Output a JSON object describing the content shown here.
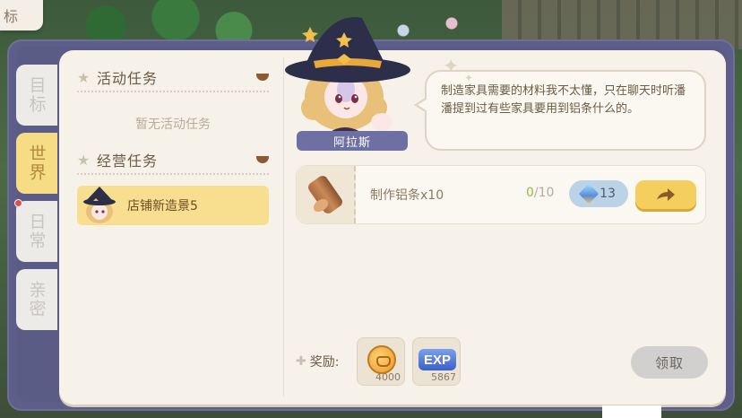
{
  "corner_tag": "标",
  "tabs": [
    {
      "label": "目标",
      "active": false,
      "dot": false
    },
    {
      "label": "世界",
      "active": true,
      "dot": false
    },
    {
      "label": "日常",
      "active": false,
      "dot": true
    },
    {
      "label": "亲密",
      "active": false,
      "dot": false
    }
  ],
  "left": {
    "activity_title": "活动任务",
    "activity_empty": "暂无活动任务",
    "business_title": "经营任务",
    "business_task": "店铺新造景5"
  },
  "npc": {
    "name": "阿拉斯",
    "dialog": "制造家具需要的材料我不太懂，只在聊天时听潘潘提到过有些家具要用到铝条什么的。"
  },
  "task": {
    "name": "制作铝条x10",
    "progress_current": "0",
    "progress_sep": "/",
    "progress_total": "10",
    "cost": "13"
  },
  "rewards": {
    "label": "奖励:",
    "coin_qty": "4000",
    "exp_label": "EXP",
    "exp_qty": "5867"
  },
  "claim_label": "领取"
}
